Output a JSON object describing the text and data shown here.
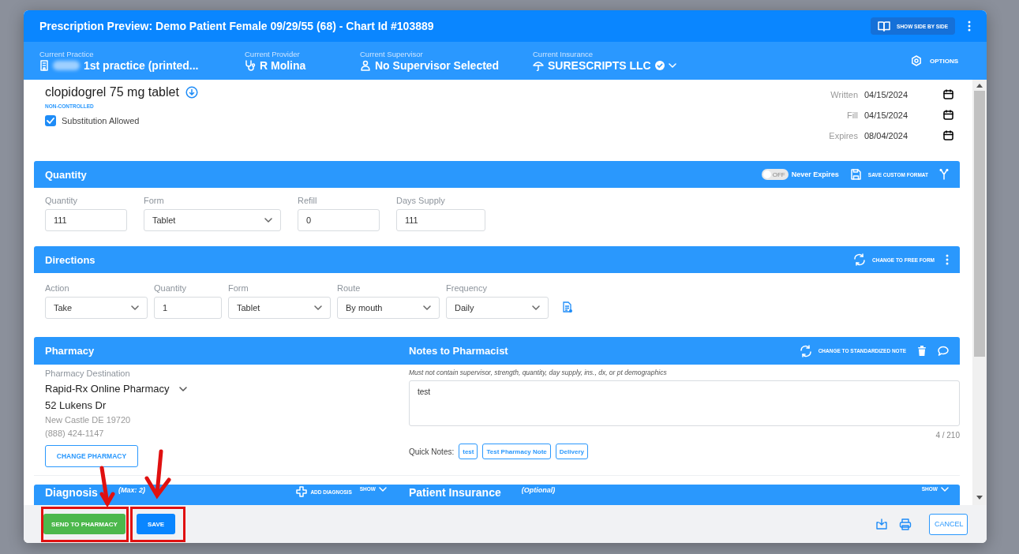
{
  "modal": {
    "title": "Prescription Preview: Demo Patient Female 09/29/55 (68) - Chart Id #103889",
    "side_by_side_button": "SHOW SIDE BY SIDE"
  },
  "context_bar": {
    "practice": {
      "label": "Current Practice",
      "value": "1st practice (printed..."
    },
    "provider": {
      "label": "Current Provider",
      "value": "R Molina"
    },
    "supervisor": {
      "label": "Current Supervisor",
      "value": "No Supervisor Selected"
    },
    "insurance": {
      "label": "Current Insurance",
      "value": "SURESCRIPTS LLC",
      "verified": true
    },
    "options_button": "OPTIONS"
  },
  "drug": {
    "name": "clopidogrel 75 mg tablet",
    "schedule": "NON-CONTROLLED",
    "substitution": {
      "label": "Substitution Allowed",
      "checked": true
    }
  },
  "dates": [
    {
      "label": "Written",
      "value": "04/15/2024"
    },
    {
      "label": "Fill",
      "value": "04/15/2024"
    },
    {
      "label": "Expires",
      "value": "08/04/2024"
    }
  ],
  "quantity_section": {
    "title": "Quantity",
    "never_expires": {
      "label": "Never Expires",
      "toggle_text": "OFF",
      "on": false
    },
    "save_format_button": "SAVE CUSTOM FORMAT",
    "fields": [
      {
        "label": "Quantity",
        "value": "111",
        "kind": "input"
      },
      {
        "label": "Form",
        "value": "Tablet",
        "kind": "select"
      },
      {
        "label": "Refill",
        "value": "0",
        "kind": "input"
      },
      {
        "label": "Days Supply",
        "value": "111",
        "kind": "input"
      }
    ]
  },
  "directions_section": {
    "title": "Directions",
    "change_button": "CHANGE TO FREE FORM",
    "fields": [
      {
        "label": "Action",
        "value": "Take",
        "kind": "select"
      },
      {
        "label": "Quantity",
        "value": "1",
        "kind": "input"
      },
      {
        "label": "Form",
        "value": "Tablet",
        "kind": "select"
      },
      {
        "label": "Route",
        "value": "By mouth",
        "kind": "select"
      },
      {
        "label": "Frequency",
        "value": "Daily",
        "kind": "select"
      }
    ]
  },
  "pharmacy_section": {
    "title": "Pharmacy",
    "destination_label": "Pharmacy Destination",
    "pharmacy_name": "Rapid-Rx Online Pharmacy",
    "address": "52 Lukens Dr",
    "city": "New Castle DE 19720",
    "phone": "(888) 424-1147",
    "change_button": "CHANGE PHARMACY"
  },
  "notes_section": {
    "title": "Notes to Pharmacist",
    "change_button": "CHANGE TO STANDARDIZED NOTE",
    "hint": "Must not contain supervisor, strength, quantity, day supply, ins., dx, or pt demographics",
    "value": "test",
    "counter": "4 / 210",
    "quick_notes_label": "Quick Notes:",
    "quick_notes": [
      "test",
      "Test Pharmacy Note",
      "Delivery"
    ]
  },
  "collapsed_sections": [
    {
      "title": "Diagnosis",
      "subtitle": "(Max: 2)",
      "action": "ADD DIAGNOSIS",
      "toggle": "SHOW"
    },
    {
      "title": "Patient Insurance",
      "subtitle": "(Optional)",
      "toggle": "SHOW"
    }
  ],
  "footer": {
    "buttons": [
      {
        "label": "SEND TO PHARMACY",
        "kind": "success"
      },
      {
        "label": "SAVE",
        "kind": "primary"
      }
    ],
    "cancel_button": "CANCEL"
  }
}
